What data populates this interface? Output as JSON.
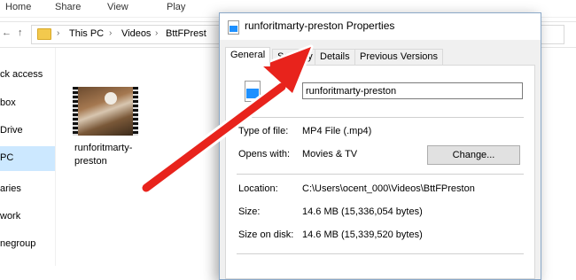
{
  "ribbon": {
    "tabs": [
      "Home",
      "Share",
      "View",
      "Play"
    ]
  },
  "addressbar": {
    "back_arrow": "←",
    "up_arrow": "↑",
    "crumbs": [
      "This PC",
      "Videos",
      "BttFPrest"
    ],
    "separator": "›"
  },
  "navpane": {
    "items": [
      "ck access",
      "box",
      "Drive",
      "PC",
      "aries",
      "work",
      "negroup"
    ],
    "selected_index": 3
  },
  "file": {
    "name": "runforitmarty-preston"
  },
  "dialog": {
    "title": "runforitmarty-preston Properties",
    "icon": "mp4-file-icon",
    "tabs": [
      "General",
      "Security",
      "Details",
      "Previous Versions"
    ],
    "active_tab": "General",
    "name_value": "runforitmarty-preston",
    "type_label": "Type of file:",
    "type_value": "MP4 File (.mp4)",
    "opens_label": "Opens with:",
    "opens_value": "Movies & TV",
    "change_label": "Change...",
    "location_label": "Location:",
    "location_value": "C:\\Users\\ocent_000\\Videos\\BttFPreston",
    "size_label": "Size:",
    "size_value": "14.6 MB (15,336,054 bytes)",
    "disk_label": "Size on disk:",
    "disk_value": "14.6 MB (15,339,520 bytes)"
  },
  "colors": {
    "arrow": "#e8231c",
    "selection": "#cce8ff",
    "accent": "#1e90ff"
  }
}
